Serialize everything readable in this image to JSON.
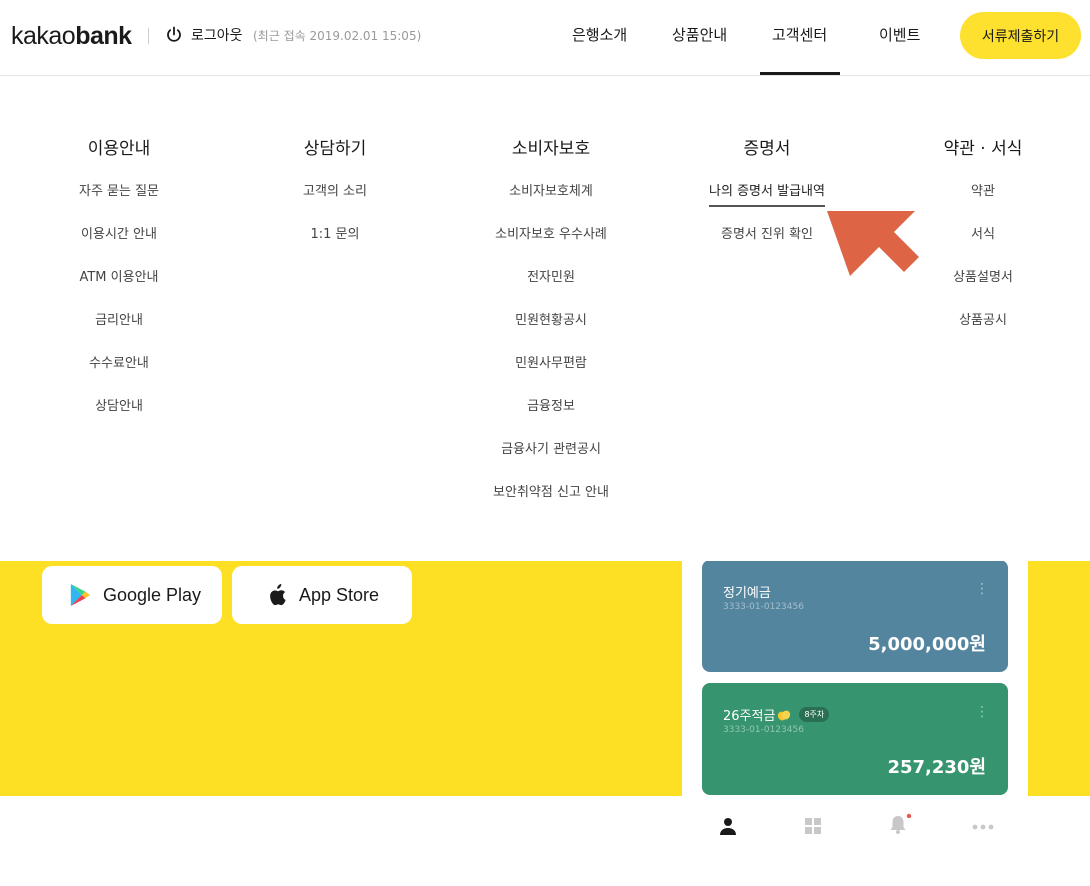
{
  "header": {
    "logo_light": "kakao",
    "logo_bold": "bank",
    "logout_label": "로그아웃",
    "last_login": "(최근 접속 2019.02.01 15:05)",
    "nav": [
      {
        "label": "은행소개",
        "active": false
      },
      {
        "label": "상품안내",
        "active": false
      },
      {
        "label": "고객센터",
        "active": true
      },
      {
        "label": "이벤트",
        "active": false
      }
    ],
    "submit_label": "서류제출하기"
  },
  "menu": {
    "columns": [
      {
        "title": "이용안내",
        "items": [
          "자주 묻는 질문",
          "이용시간 안내",
          "ATM 이용안내",
          "금리안내",
          "수수료안내",
          "상담안내"
        ]
      },
      {
        "title": "상담하기",
        "items": [
          "고객의 소리",
          "1:1 문의"
        ]
      },
      {
        "title": "소비자보호",
        "items": [
          "소비자보호체계",
          "소비자보호 우수사례",
          "전자민원",
          "민원현황공시",
          "민원사무편람",
          "금융정보",
          "금융사기 관련공시",
          "보안취약점 신고 안내"
        ]
      },
      {
        "title": "증명서",
        "items": [
          "나의 증명서 발급내역",
          "증명서 진위 확인"
        ]
      },
      {
        "title": "약관 · 서식",
        "items": [
          "약관",
          "서식",
          "상품설명서",
          "상품공시"
        ]
      }
    ],
    "highlighted": "나의 증명서 발급내역"
  },
  "stores": {
    "google_label": "Google Play",
    "apple_label": "App Store"
  },
  "phone": {
    "cards": [
      {
        "name": "정기예금",
        "number": "3333-01-0123456",
        "balance": "5,000,000원",
        "color": "#54859f"
      },
      {
        "name": "26주적금",
        "badge": "8주차",
        "number": "3333-01-0123456",
        "balance": "257,230원",
        "color": "#36946f"
      }
    ]
  },
  "colors": {
    "brand_yellow": "#fde023",
    "button_yellow": "#fee02f",
    "arrow": "#de6446"
  }
}
